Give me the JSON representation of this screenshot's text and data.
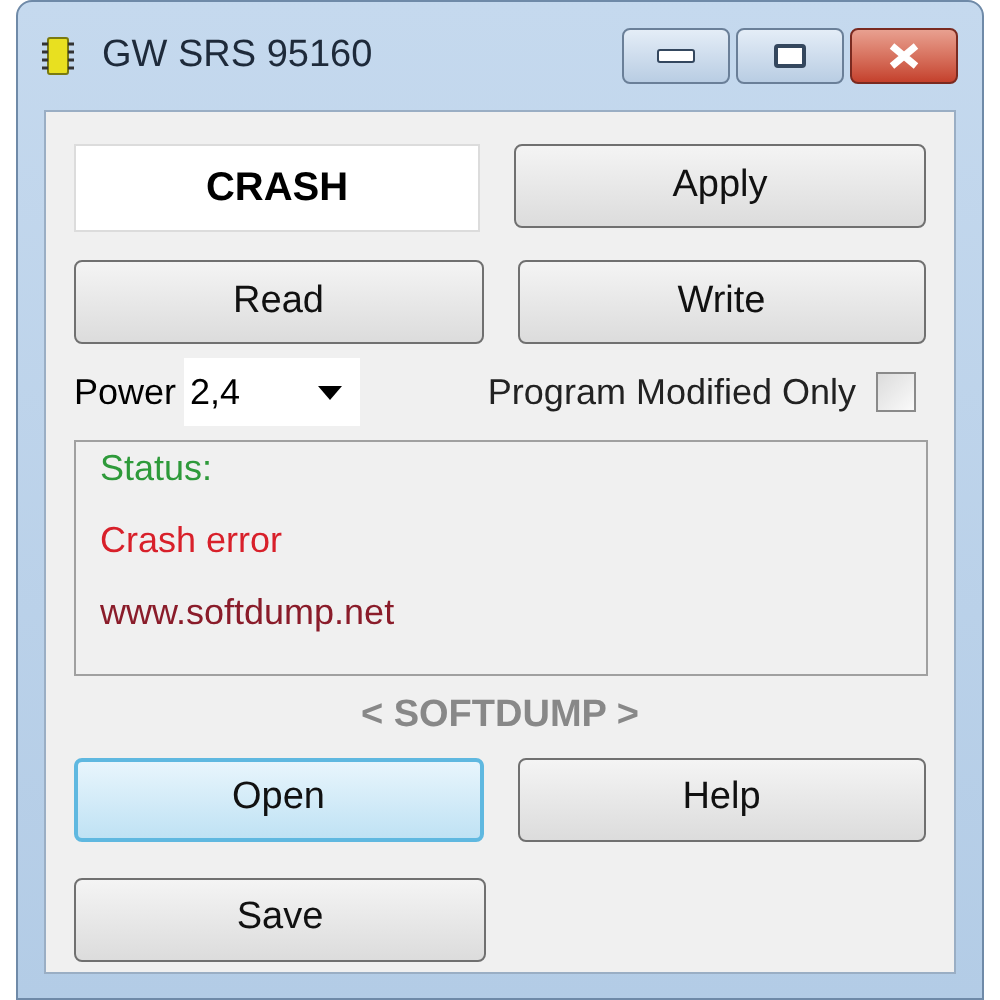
{
  "window": {
    "title": "GW SRS 95160"
  },
  "mode_display": {
    "value": "CRASH"
  },
  "button_rows": [
    [
      {
        "label": "Apply",
        "focused": false
      }
    ],
    [
      {
        "label": "Read",
        "focused": false
      },
      {
        "label": "Write",
        "focused": false
      }
    ]
  ],
  "power": {
    "label": "Power",
    "value": "2,4"
  },
  "program_modified_only": {
    "label": "Program Modified Only",
    "checked": false
  },
  "status_box": {
    "lines": [
      {
        "text": "Status:",
        "color": "#2e9a3a"
      },
      {
        "text": "Crash error",
        "color": "#d8202a"
      },
      {
        "text": "www.softdump.net",
        "color": "#8a1c2a"
      }
    ]
  },
  "banner": "< SOFTDUMP >",
  "bottom_buttons": [
    [
      {
        "label": "Open",
        "focused": true
      },
      {
        "label": "Help",
        "focused": false
      }
    ],
    [
      {
        "label": "Save",
        "focused": false
      }
    ]
  ]
}
